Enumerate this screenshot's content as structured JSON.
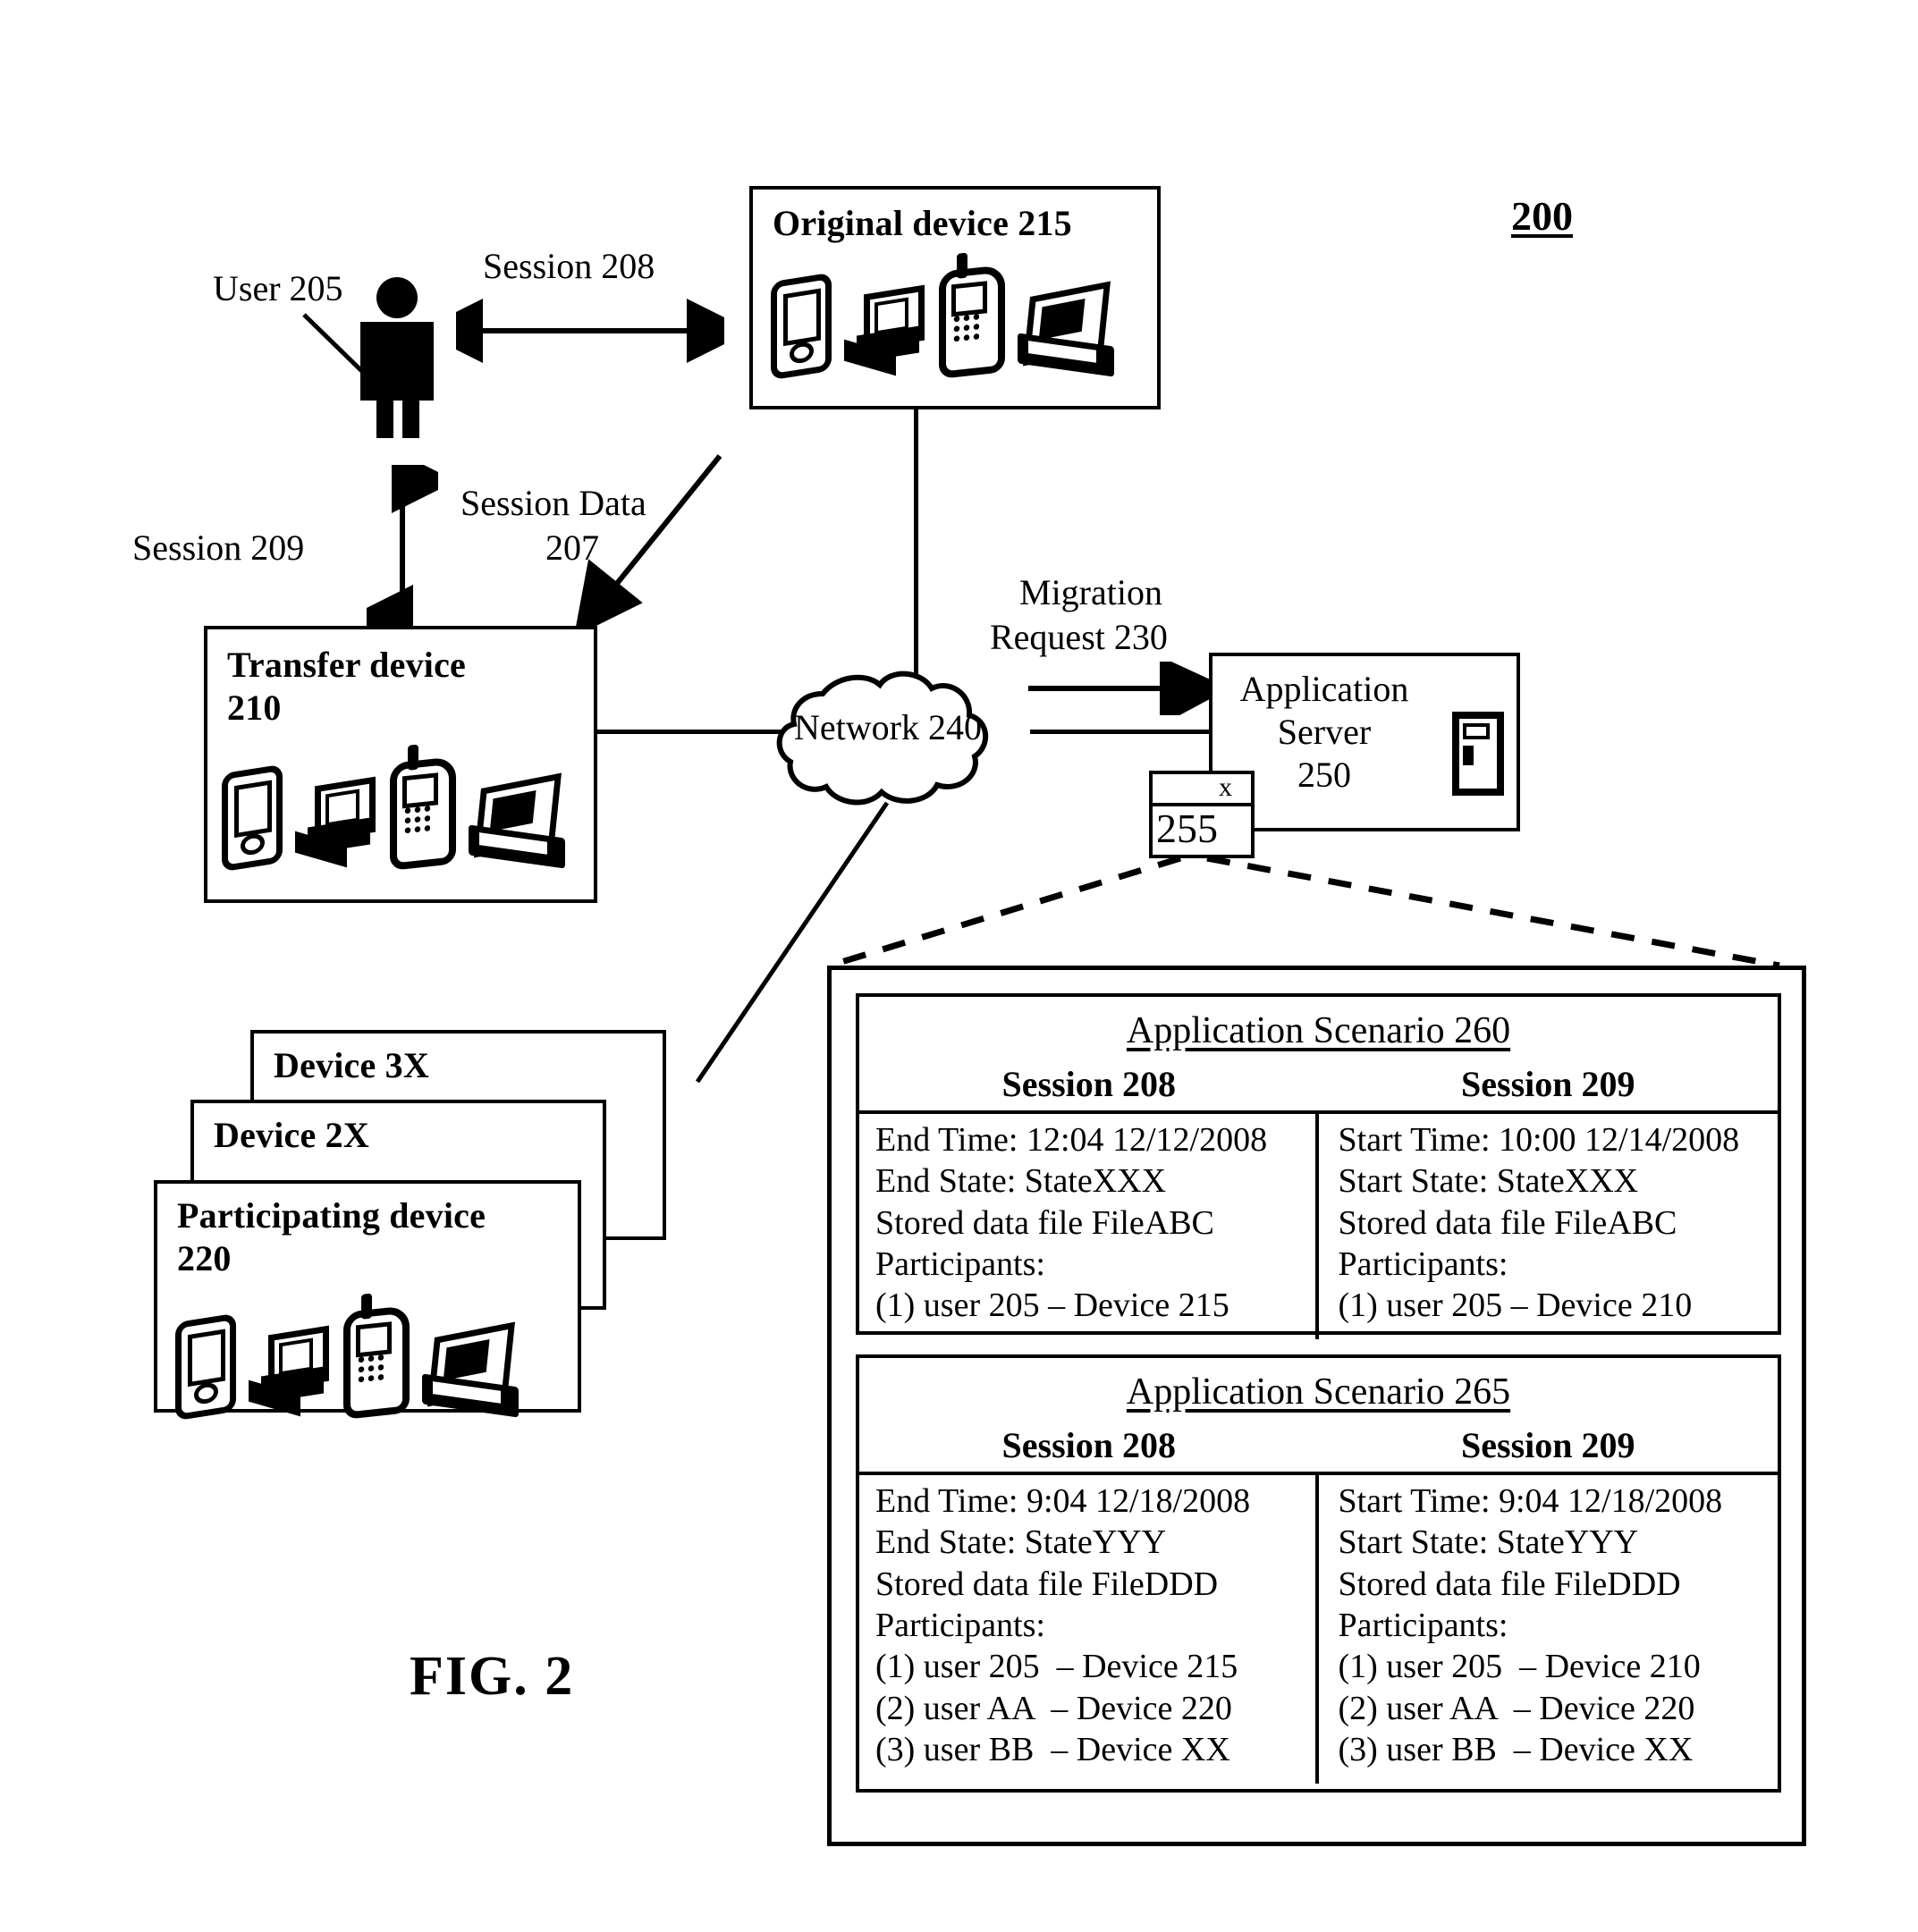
{
  "figure": {
    "number_label": "200",
    "caption": "FIG. 2"
  },
  "actors": {
    "user_label": "User 205"
  },
  "connectors": {
    "session_208": "Session 208",
    "session_209": "Session 209",
    "session_data_207_line1": "Session Data",
    "session_data_207_line2": "207",
    "migration_request_line1": "Migration",
    "migration_request_line2": "Request 230"
  },
  "nodes": {
    "original_device": {
      "title_line1": "Original device 215"
    },
    "transfer_device": {
      "title_line1": "Transfer device",
      "title_line2": "210"
    },
    "participating_device": {
      "title_line1": "Participating device",
      "title_line2": "220"
    },
    "device_2x": {
      "title": "Device 2X"
    },
    "device_3x": {
      "title": "Device 3X"
    },
    "network": {
      "label": "Network 240"
    },
    "application_server": {
      "line1": "Application",
      "line2": "Server",
      "line3": "250"
    },
    "storage_255": {
      "mark": "x",
      "label": "255"
    }
  },
  "detail": {
    "scenarios": [
      {
        "title": "Application Scenario 260",
        "columns": [
          {
            "heading": "Session 208",
            "lines": [
              "End Time: 12:04 12/12/2008",
              "End State: StateXXX",
              "Stored data file FileABC",
              "Participants:",
              "(1) user 205 – Device 215"
            ]
          },
          {
            "heading": "Session 209",
            "lines": [
              "Start Time: 10:00 12/14/2008",
              "Start State: StateXXX",
              "Stored data file FileABC",
              "Participants:",
              "(1) user 205 – Device 210"
            ]
          }
        ]
      },
      {
        "title": "Application Scenario 265",
        "columns": [
          {
            "heading": "Session 208",
            "lines": [
              "End Time: 9:04 12/18/2008",
              "End State: StateYYY",
              "Stored data file FileDDD",
              "Participants:",
              "(1) user 205  – Device 215",
              "(2) user AA  – Device 220",
              "(3) user BB  – Device XX"
            ]
          },
          {
            "heading": "Session 209",
            "lines": [
              "Start Time: 9:04 12/18/2008",
              "Start State: StateYYY",
              "Stored data file FileDDD",
              "Participants:",
              "(1) user 205  – Device 210",
              "(2) user AA  – Device 220",
              "(3) user BB  – Device XX"
            ]
          }
        ]
      }
    ]
  },
  "colors": {
    "ink": "#000000",
    "paper": "#ffffff"
  }
}
